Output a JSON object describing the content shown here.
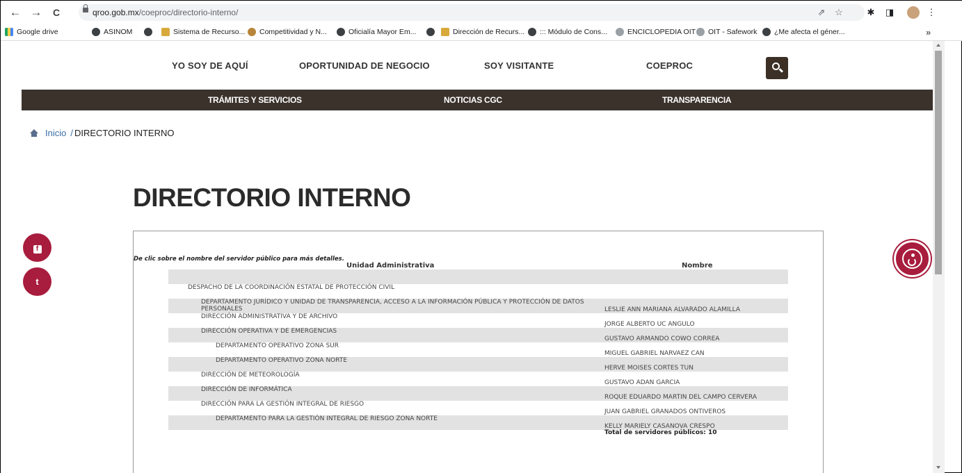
{
  "browser": {
    "url_host": "qroo.gob.mx",
    "url_path": "/coeproc/directorio-interno/",
    "nav": {
      "back": "←",
      "forward": "→",
      "reload": "C"
    },
    "toolbar_icons": [
      {
        "name": "share-icon",
        "glyph": "⇗"
      },
      {
        "name": "star-icon",
        "glyph": "☆"
      },
      {
        "name": "extensions-icon",
        "glyph": "✱"
      },
      {
        "name": "sidepanel-icon",
        "glyph": "◨"
      },
      {
        "name": "menu-icon",
        "glyph": "⋮"
      }
    ],
    "bookmarks": [
      "Google drive",
      "ASINOM",
      "",
      "Sistema de Recurso...",
      "Competitividad y N...",
      "Oficialía Mayor Em...",
      "",
      "Dirección de Recurs...",
      "::: Módulo de Cons...",
      "ENCICLOPEDIA OIT",
      "OIT - Safework",
      "¿Me afecta el géner..."
    ],
    "bookmarks_more": "»"
  },
  "site": {
    "topnav": [
      "YO SOY DE AQUÍ",
      "OPORTUNIDAD DE NEGOCIO",
      "SOY VISITANTE",
      "COEPROC"
    ],
    "mainnav": [
      "TRÁMITES Y SERVICIOS",
      "NOTICIAS CGC",
      "TRANSPARENCIA"
    ],
    "breadcrumb": {
      "home": "Inicio",
      "sep": "/",
      "current": "DIRECTORIO INTERNO"
    },
    "title": "DIRECTORIO INTERNO",
    "social": {
      "facebook": "f",
      "twitter": "t"
    }
  },
  "directory": {
    "hint": "De clic sobre el nombre del servidor público para más detalles.",
    "col_unit": "Unidad Administrativa",
    "col_name": "Nombre",
    "rows": [
      {
        "unit": "",
        "name": ""
      },
      {
        "unit": "DESPACHO DE LA COORDINACIÓN ESTATAL DE PROTECCIÓN CIVIL",
        "name": ""
      },
      {
        "unit": "DEPARTAMENTO JURÍDICO Y UNIDAD DE TRANSPARENCIA, ACCESO A LA INFORMACIÓN PÚBLICA Y PROTECCIÓN DE DATOS",
        "unit2": "PERSONALES",
        "name": "LESLIE ANN MARIANA ALVARADO ALAMILLA"
      },
      {
        "unit": "DIRECCIÓN ADMINISTRATIVA Y DE ARCHIVO",
        "name": "JORGE ALBERTO UC ANGULO"
      },
      {
        "unit": "DIRECCIÓN OPERATIVA Y DE EMERGENCIAS",
        "name": "GUSTAVO ARMANDO COWO CORREA"
      },
      {
        "unit": "DEPARTAMENTO OPERATIVO ZONA SUR",
        "name": "MIGUEL GABRIEL NARVAEZ CAN"
      },
      {
        "unit": "DEPARTAMENTO OPERATIVO ZONA NORTE",
        "name": "HERVE MOISES CORTES TUN"
      },
      {
        "unit": "DIRECCIÓN DE METEOROLOGÍA",
        "name": "GUSTAVO ADAN GARCIA"
      },
      {
        "unit": "DIRECCIÓN DE INFORMÁTICA",
        "name": "ROQUE EDUARDO MARTIN DEL CAMPO CERVERA"
      },
      {
        "unit": "DIRECCIÓN PARA LA GESTIÓN INTEGRAL DE RIESGO",
        "name": "JUAN GABRIEL GRANADOS ONTIVEROS"
      },
      {
        "unit": "DEPARTAMENTO PARA LA GESTIÓN INTEGRAL DE RIESGO ZONA NORTE",
        "name": "KELLY MARIELY CASANOVA CRESPO"
      }
    ],
    "total": "Total de servidores públicos:  10"
  },
  "colors": {
    "darkbar": "#3b322c",
    "accent": "#a81c3d",
    "row_shade": "#e2e2e2",
    "link": "#3a6ea5"
  }
}
